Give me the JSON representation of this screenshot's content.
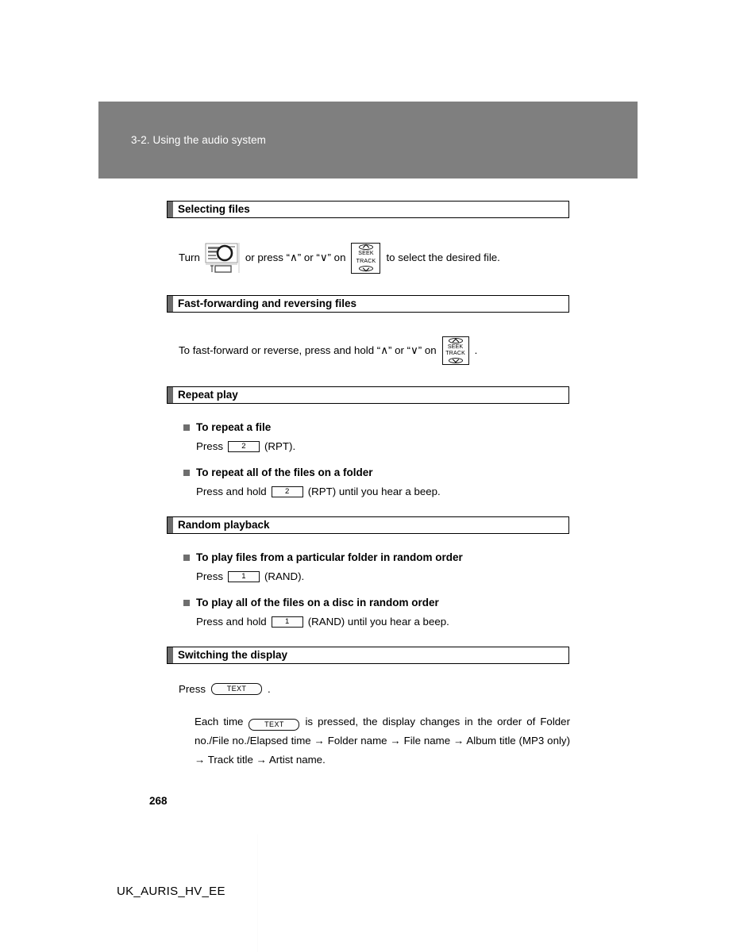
{
  "chapter": {
    "label": "3-2. Using the audio system"
  },
  "sections": [
    {
      "id": "selecting-files",
      "title": "Selecting files",
      "instruction": {
        "before": "Turn",
        "middle_a": "or press “∧” or “∨” on",
        "after": "to select the desired file."
      }
    },
    {
      "id": "fast-forwarding",
      "title": "Fast-forwarding and reversing files",
      "instruction": {
        "before": "To fast-forward or reverse, press and hold “∧” or “∨” on",
        "after": "."
      }
    },
    {
      "id": "repeat-play",
      "title": "Repeat play",
      "items": [
        {
          "heading": "To repeat a file",
          "before": "Press",
          "key": "2",
          "after": "(RPT)."
        },
        {
          "heading": "To repeat all of the files on a folder",
          "before": "Press and hold",
          "key": "2",
          "after": "(RPT) until you hear a beep."
        }
      ]
    },
    {
      "id": "random-playback",
      "title": "Random playback",
      "items": [
        {
          "heading": "To play files from a particular folder in random order",
          "before": "Press",
          "key": "1",
          "after": "(RAND)."
        },
        {
          "heading": "To play all of the files on a disc in random order",
          "before": "Press and hold",
          "key": "1",
          "after": "(RAND) until you hear a beep."
        }
      ]
    },
    {
      "id": "switching-display",
      "title": "Switching the display",
      "press_line": {
        "before": "Press",
        "key": "TEXT",
        "after": "."
      },
      "explanation": {
        "before": "Each time",
        "key": "TEXT",
        "after": "is pressed, the display changes in the order of Folder no./File no./Elapsed time → Folder name → File name → Album title (MP3 only) → Track title → Artist name."
      }
    }
  ],
  "seek_switch": {
    "line1": "SEEK",
    "line2": "TRACK",
    "up_icon": "chevron-up-icon",
    "down_icon": "chevron-down-icon"
  },
  "icons": {
    "knob": "audio-tune-knob-icon",
    "bullet": "filled-square-bullet-icon"
  },
  "footer": {
    "page_number": "268",
    "document_code": "UK_AURIS_HV_EE"
  },
  "colors": {
    "chapter_band": "#7f7f7f",
    "section_tab": "#6b6b6b",
    "bullet": "#6e6e6e",
    "text": "#000000",
    "page_background": "#ffffff"
  }
}
